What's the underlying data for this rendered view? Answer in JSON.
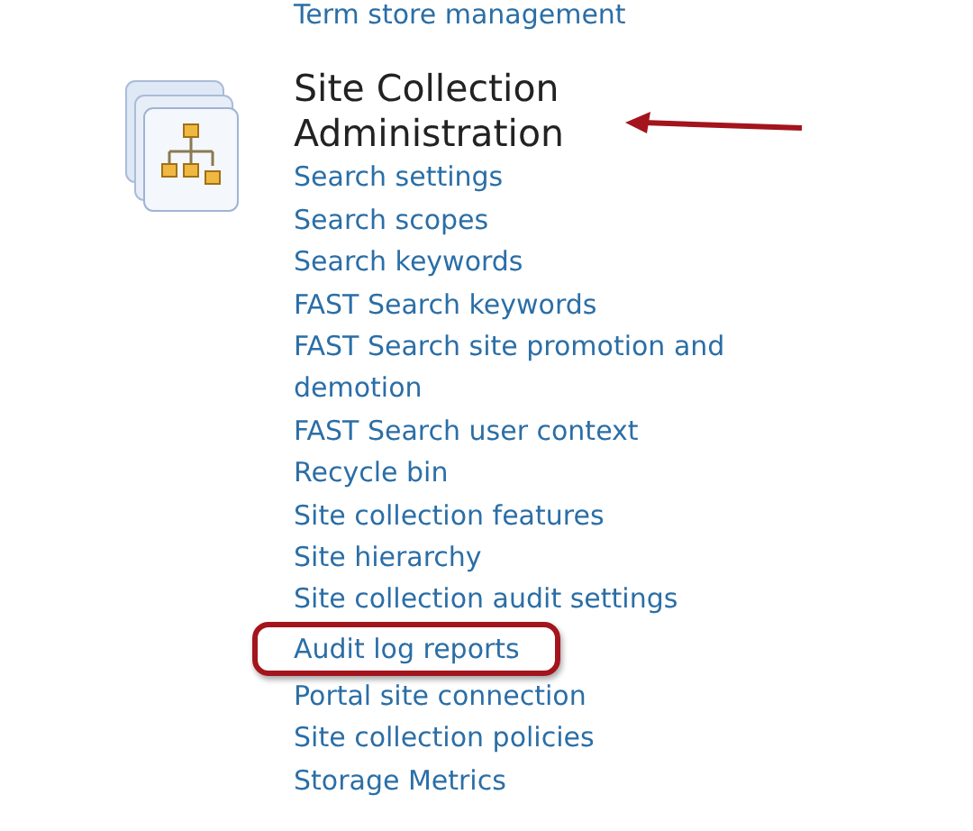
{
  "previous_link": "Term store management",
  "section": {
    "title": "Site Collection Administration",
    "annotated": true,
    "links": [
      {
        "label": "Search settings",
        "highlighted": false
      },
      {
        "label": "Search scopes",
        "highlighted": false
      },
      {
        "label": "Search keywords",
        "highlighted": false
      },
      {
        "label": "FAST Search keywords",
        "highlighted": false
      },
      {
        "label": "FAST Search site promotion and demotion",
        "highlighted": false
      },
      {
        "label": "FAST Search user context",
        "highlighted": false
      },
      {
        "label": "Recycle bin",
        "highlighted": false
      },
      {
        "label": "Site collection features",
        "highlighted": false
      },
      {
        "label": "Site hierarchy",
        "highlighted": false
      },
      {
        "label": "Site collection audit settings",
        "highlighted": false
      },
      {
        "label": "Audit log reports",
        "highlighted": true
      },
      {
        "label": "Portal site connection",
        "highlighted": false
      },
      {
        "label": "Site collection policies",
        "highlighted": false
      },
      {
        "label": "Storage Metrics",
        "highlighted": false
      }
    ]
  }
}
